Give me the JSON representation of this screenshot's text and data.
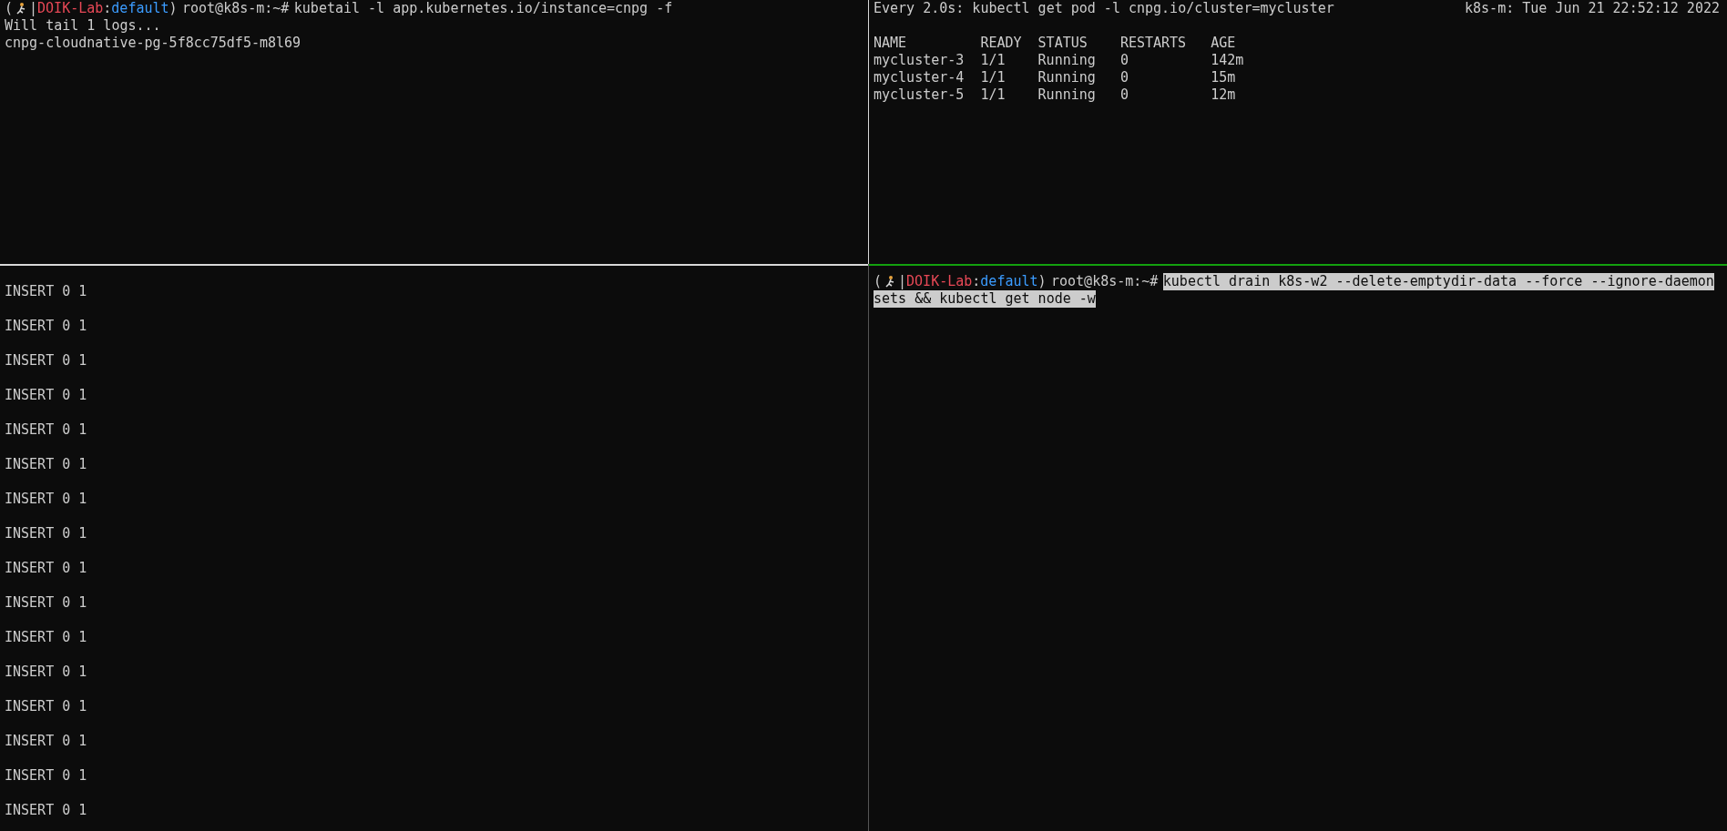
{
  "rows": [
    {
      "panes": [
        {
          "kind": "log",
          "prompt": {
            "open": "(",
            "bar": "|",
            "context": "DOIK-Lab",
            "colon": ":",
            "namespace": "default",
            "close": ")",
            "user_host": "root@k8s-m:~#",
            "command": "kubetail -l app.kubernetes.io/instance=cnpg -f"
          },
          "lines": [
            "Will tail 1 logs...",
            "cnpg-cloudnative-pg-5f8cc75df5-m8l69"
          ]
        },
        {
          "kind": "watch",
          "header": "Every 2.0s: kubectl get pod -l cnpg.io/cluster=mycluster",
          "clock": "k8s-m: Tue Jun 21 22:52:12 2022",
          "table": {
            "columns": [
              "NAME",
              "READY",
              "STATUS",
              "RESTARTS",
              "AGE"
            ],
            "rows": [
              [
                "mycluster-3",
                "1/1",
                "Running",
                "0",
                "142m"
              ],
              [
                "mycluster-4",
                "1/1",
                "Running",
                "0",
                "15m"
              ],
              [
                "mycluster-5",
                "1/1",
                "Running",
                "0",
                "12m"
              ]
            ]
          }
        }
      ]
    },
    {
      "panes": [
        {
          "kind": "output",
          "active": false,
          "lines": [
            "INSERT 0 1",
            "INSERT 0 1",
            "INSERT 0 1",
            "INSERT 0 1",
            "INSERT 0 1",
            "INSERT 0 1",
            "INSERT 0 1",
            "INSERT 0 1",
            "INSERT 0 1",
            "INSERT 0 1",
            "INSERT 0 1",
            "INSERT 0 1",
            "INSERT 0 1",
            "INSERT 0 1",
            "INSERT 0 1",
            "INSERT 0 1"
          ]
        },
        {
          "kind": "shell",
          "active": true,
          "prompt": {
            "open": "(",
            "bar": "|",
            "context": "DOIK-Lab",
            "colon": ":",
            "namespace": "default",
            "close": ")",
            "user_host": "root@k8s-m:~#",
            "command_lines": [
              "kubectl drain k8s-w2 --delete-emptydir-data --force --ignore-daemon",
              "sets && kubectl get node -w"
            ],
            "selected": true
          }
        }
      ]
    }
  ]
}
